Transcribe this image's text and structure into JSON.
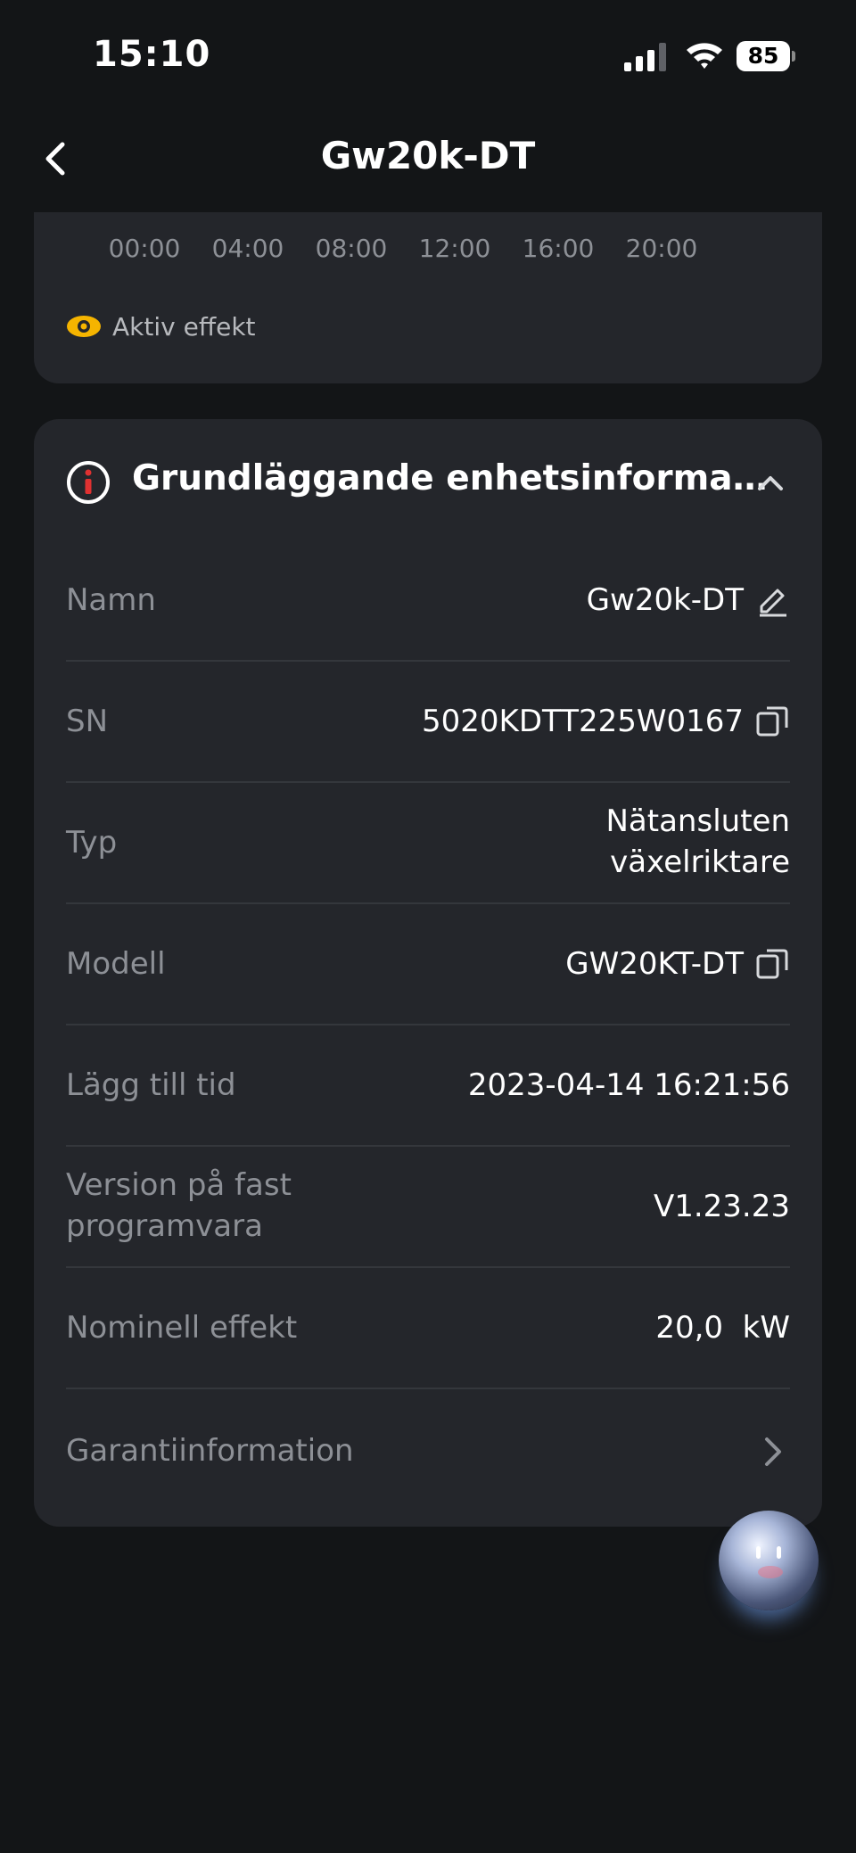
{
  "status_bar": {
    "time": "15:10",
    "battery_level": "85",
    "icons": [
      "signal-icon",
      "wifi-icon",
      "battery-icon"
    ]
  },
  "nav": {
    "title": "Gw20k-DT",
    "back_icon": "chevron-left-icon"
  },
  "chart": {
    "x_ticks": [
      "00:00",
      "04:00",
      "08:00",
      "12:00",
      "16:00",
      "20:00"
    ],
    "legend": {
      "label": "Aktiv effekt",
      "color": "#f5b400"
    }
  },
  "device_info": {
    "title": "Grundläggande enhetsinformat...",
    "rows": [
      {
        "label": "Namn",
        "value": "Gw20k-DT",
        "icon": "edit-icon"
      },
      {
        "label": "SN",
        "value": "5020KDTT225W0167",
        "icon": "copy-icon"
      },
      {
        "label": "Typ",
        "value_line1": "Nätansluten",
        "value_line2": "växelriktare"
      },
      {
        "label": "Modell",
        "value": "GW20KT-DT",
        "icon": "copy-icon"
      },
      {
        "label": "Lägg till tid",
        "value": "2023-04-14 16:21:56"
      },
      {
        "label_line1": "Version på fast",
        "label_line2": "programvara",
        "value": "V1.23.23"
      },
      {
        "label": "Nominell effekt",
        "value": "20,0  kW"
      },
      {
        "label": "Garantiinformation",
        "icon": "chevron-right-icon"
      }
    ]
  },
  "colors": {
    "background": "#131517",
    "card": "#24262b",
    "accent": "#f5b400",
    "info_icon_red": "#e03131"
  }
}
